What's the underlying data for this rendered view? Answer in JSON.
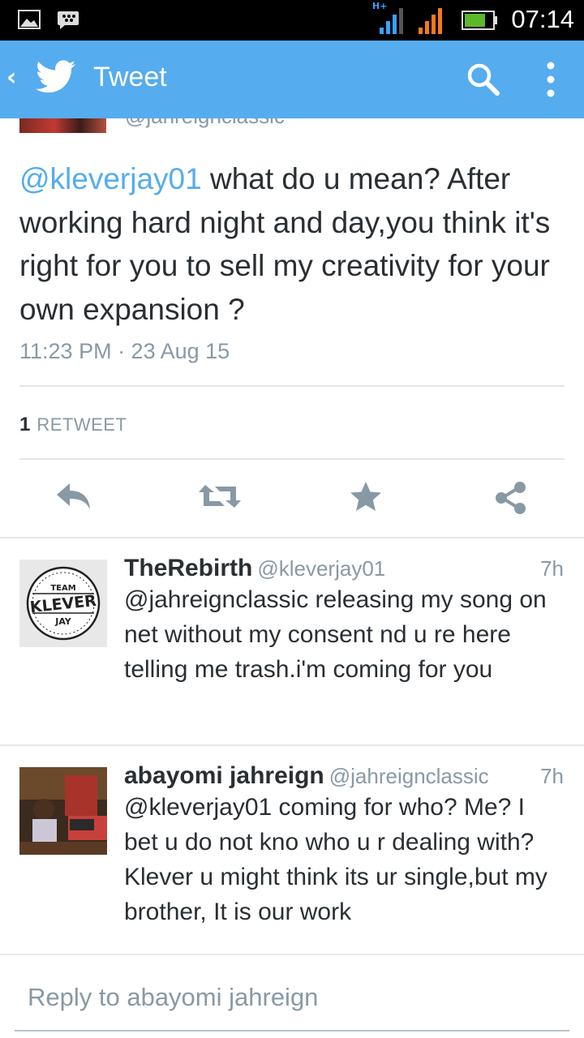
{
  "status_bar": {
    "time": "07:14",
    "network_type": "H+",
    "icons": [
      "image-icon",
      "bbm-icon",
      "signal-icon",
      "signal-icon-2",
      "battery-icon"
    ]
  },
  "action_bar": {
    "title": "Tweet",
    "icons": [
      "back-icon",
      "twitter-bird-icon",
      "search-icon",
      "overflow-menu-icon"
    ],
    "brand_color": "#55acee"
  },
  "previous_tweet": {
    "handle": "@jahreignclassic"
  },
  "main_tweet": {
    "mention": "@kleverjay01",
    "text": " what do u mean? After working hard night and day,you  think it's right for you to sell my creativity for your own expansion ?",
    "timestamp": "11:23 PM · 23 Aug 15",
    "retweet_count": "1",
    "retweet_label": "RETWEET",
    "actions": [
      "reply-icon",
      "retweet-icon",
      "favorite-icon",
      "share-icon"
    ]
  },
  "replies": [
    {
      "name": "TheRebirth",
      "handle": "@kleverjay01",
      "age": "7h",
      "text": "@jahreignclassic releasing my song on net without my consent nd u re here telling me trash.i'm coming for you",
      "avatar_text": {
        "top": "TEAM",
        "middle": "KLEVER",
        "bottom": "JAY"
      }
    },
    {
      "name": "abayomi jahreign",
      "handle": "@jahreignclassic",
      "age": "7h",
      "text": "@kleverjay01 coming for who? Me? I bet u do not kno who u r dealing with? Klever u might think its ur single,but my brother, It is our work"
    }
  ],
  "composer": {
    "placeholder": "Reply to abayomi jahreign"
  },
  "colors": {
    "accent": "#55acee",
    "text": "#292f33",
    "muted": "#8899a6",
    "icon": "#8899a6",
    "divider": "#e1e8ed"
  }
}
